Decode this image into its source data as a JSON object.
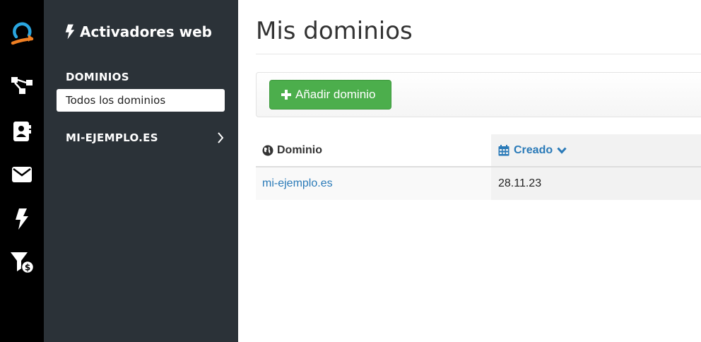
{
  "colors": {
    "rail_bg": "#000000",
    "sidebar_bg": "#2b3238",
    "brand_blue": "#2aa6e0",
    "brand_orange": "#f07f23",
    "success_green": "#4cae4c",
    "link_blue": "#2a7ab8"
  },
  "rail": {
    "icons": [
      "logo-icon",
      "flow-icon",
      "contacts-icon",
      "envelope-icon",
      "bolt-icon",
      "funnel-dollar-icon"
    ]
  },
  "sidebar": {
    "title": "Activadores web",
    "title_icon": "bolt-icon",
    "section_label": "DOMINIOS",
    "active_item": "Todos los dominios",
    "domain_item": "MI-EJEMPLO.ES",
    "domain_item_icon": "chevron-right-icon"
  },
  "main": {
    "title": "Mis dominios",
    "add_button": "Añadir dominio",
    "table": {
      "columns": [
        {
          "label": "Dominio",
          "icon": "globe-icon"
        },
        {
          "label": "Creado",
          "icon": "calendar-icon",
          "sort_icon": "chevron-down-icon"
        }
      ],
      "rows": [
        {
          "domain": "mi-ejemplo.es",
          "created": "28.11.23"
        }
      ]
    }
  }
}
